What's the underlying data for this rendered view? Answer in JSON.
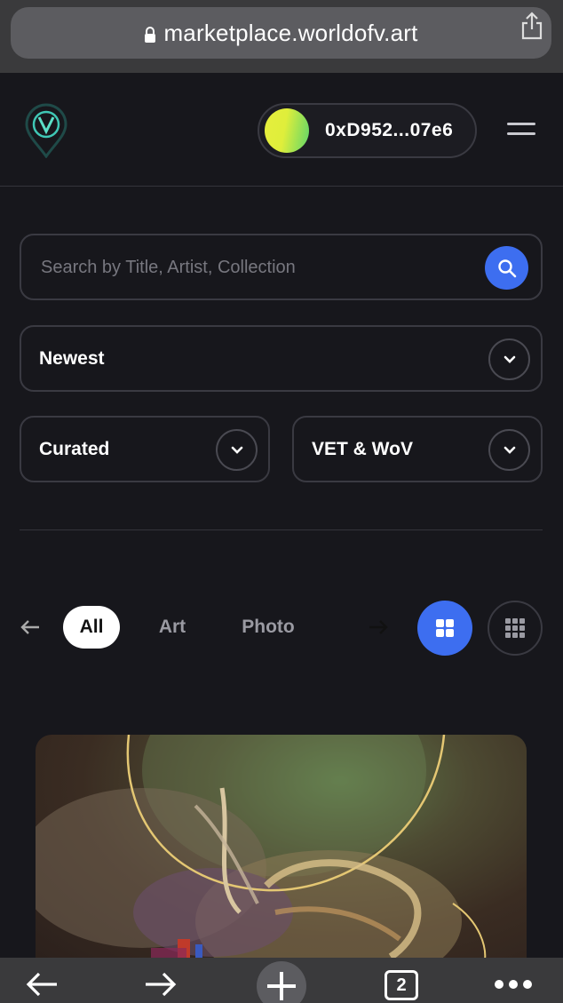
{
  "browser": {
    "url": "marketplace.worldofv.art",
    "tab_count": "2"
  },
  "header": {
    "wallet_address": "0xD952...07e6"
  },
  "search": {
    "placeholder": "Search by Title, Artist, Collection"
  },
  "filters": {
    "sort": "Newest",
    "curation": "Curated",
    "currency": "VET & WoV"
  },
  "categories": {
    "items": [
      "All",
      "Art",
      "Photo"
    ],
    "active": "All"
  },
  "colors": {
    "accent": "#3d6ef0",
    "background": "#17171c",
    "border": "#3a3a42"
  },
  "icons": [
    "lock-icon",
    "share-icon",
    "wov-logo",
    "menu-icon",
    "search-icon",
    "chevron-down-icon",
    "arrow-left-icon",
    "arrow-right-icon",
    "grid-large-icon",
    "grid-small-icon",
    "back-icon",
    "forward-icon",
    "plus-icon",
    "more-icon"
  ]
}
